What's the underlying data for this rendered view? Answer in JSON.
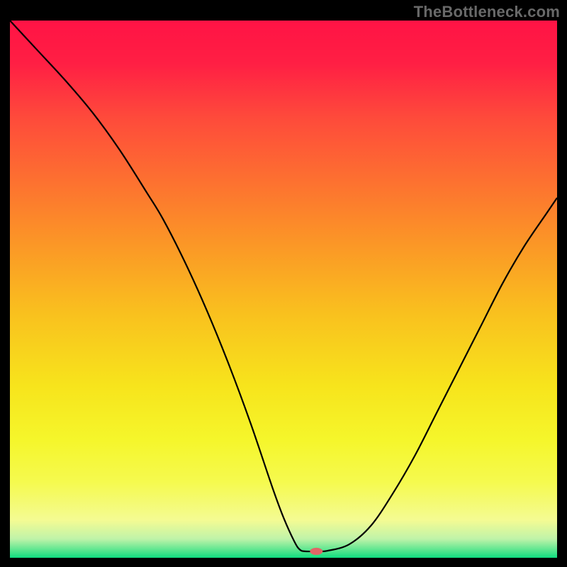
{
  "watermark": "TheBottleneck.com",
  "chart_data": {
    "type": "line",
    "title": "",
    "xlabel": "",
    "ylabel": "",
    "xlim": [
      0,
      100
    ],
    "ylim": [
      0,
      100
    ],
    "background_gradient": {
      "stops": [
        {
          "offset": 0.0,
          "color": "#ff1345"
        },
        {
          "offset": 0.08,
          "color": "#ff1f44"
        },
        {
          "offset": 0.18,
          "color": "#fe4a3b"
        },
        {
          "offset": 0.3,
          "color": "#fd7130"
        },
        {
          "offset": 0.42,
          "color": "#fb9826"
        },
        {
          "offset": 0.55,
          "color": "#f9c21e"
        },
        {
          "offset": 0.68,
          "color": "#f7e41c"
        },
        {
          "offset": 0.78,
          "color": "#f5f62b"
        },
        {
          "offset": 0.86,
          "color": "#f5fa4f"
        },
        {
          "offset": 0.93,
          "color": "#f4fb93"
        },
        {
          "offset": 0.965,
          "color": "#bff3a9"
        },
        {
          "offset": 0.985,
          "color": "#5de690"
        },
        {
          "offset": 1.0,
          "color": "#0fdd80"
        }
      ]
    },
    "series": [
      {
        "name": "bottleneck-curve",
        "color": "#000000",
        "x": [
          0,
          5,
          10,
          15,
          20,
          25,
          28,
          32,
          36,
          40,
          44,
          48,
          50,
          52,
          53,
          54,
          56,
          58,
          62,
          66,
          70,
          74,
          78,
          82,
          86,
          90,
          94,
          98,
          100
        ],
        "y": [
          100,
          94.5,
          89,
          83,
          76,
          68,
          63,
          55,
          46,
          36,
          25,
          13,
          7.5,
          3,
          1.5,
          1.2,
          1.2,
          1.3,
          2.5,
          6,
          12,
          19,
          27,
          35,
          43,
          51,
          58,
          64,
          67
        ]
      }
    ],
    "marker": {
      "name": "optimal-point",
      "x": 56,
      "y": 1.2,
      "color": "#e06666",
      "rx": 9,
      "ry": 5
    }
  }
}
